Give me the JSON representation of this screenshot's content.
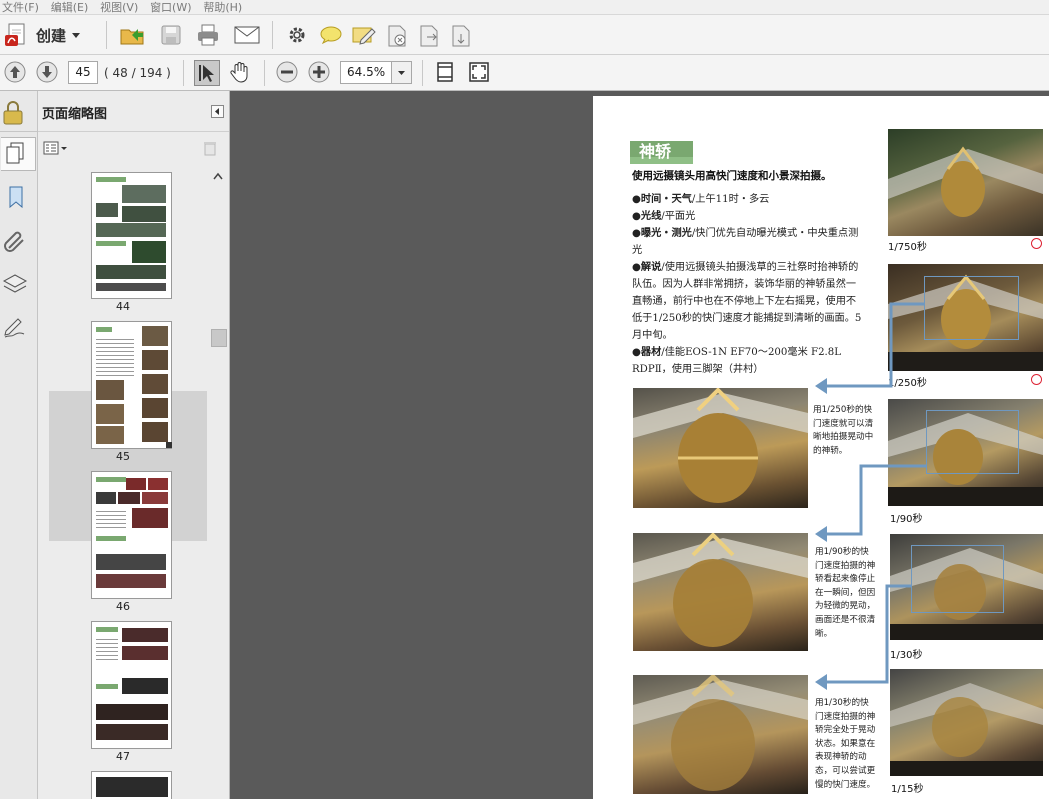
{
  "menu": [
    "文件(F)",
    "编辑(E)",
    "视图(V)",
    "窗口(W)",
    "帮助(H)"
  ],
  "toolbar": {
    "create_label": "创建",
    "page_current": "45",
    "page_count": "( 48 / 194 )",
    "zoom": "64.5%",
    "icons": [
      "create-pdf-icon",
      "open-folder-icon",
      "save-icon",
      "print-icon",
      "email-icon",
      "settings-icon",
      "comment-icon",
      "edit-icon",
      "doc-remove-icon",
      "doc-export-icon",
      "doc-import-icon",
      "arrow-up-icon",
      "arrow-down-icon",
      "select-tool-icon",
      "hand-tool-icon",
      "zoom-out-icon",
      "zoom-in-icon",
      "fit-page-icon",
      "full-screen-icon"
    ]
  },
  "left_panel": {
    "title": "页面缩略图",
    "thumbnails": [
      {
        "page": "44"
      },
      {
        "page": "45",
        "selected": true
      },
      {
        "page": "46"
      },
      {
        "page": "47"
      }
    ]
  },
  "document": {
    "section_title": "神轿",
    "subtitle": "使用远摄镜头用高快门速度和小景深拍摄。",
    "lines": [
      {
        "label": "●时间・天气",
        "text": "/上午11时・多云"
      },
      {
        "label": "●光线",
        "text": "/平面光"
      },
      {
        "label": "●曝光・测光",
        "text": "/快门优先自动曝光模式・中央重点测光"
      },
      {
        "label": "●解说",
        "text": "/使用远摄镜头拍摄浅草的三社祭时抬神轿的队伍。因为人群非常拥挤，装饰华丽的神轿虽然一直畅通，前行中也在不停地上下左右摇晃，使用不低于1/250秒的快门速度才能捕捉到清晰的画面。5月中旬。"
      },
      {
        "label": "●器材",
        "text": "/佳能EOS-1N EF70～200毫米 F2.8L RDPⅡ，使用三脚架（井村）"
      }
    ],
    "captions": [
      "1/750秒",
      "1/250秒",
      "1/90秒",
      "1/30秒",
      "1/15秒"
    ],
    "notes": [
      "用1/250秒的快门速度就可以清晰地拍摄晃动中的神轿。",
      "用1/90秒的快门速度拍摄的神轿看起来像停止在一瞬间，但因为轻微的晃动，画面还是不很清晰。",
      "用1/30秒的快门速度拍摄的神轿完全处于晃动状态。如果意在表现神轿的动态，可以尝试更慢的快门速度。"
    ]
  },
  "colors": {
    "accent_green": "#7aa870",
    "arrow_blue": "#6f98c0",
    "ok_red": "#d23"
  }
}
